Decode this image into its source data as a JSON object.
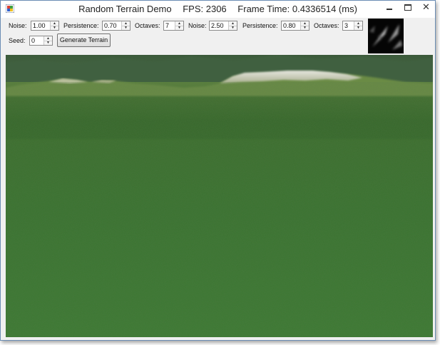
{
  "window": {
    "title": "Random Terrain Demo",
    "fps": "FPS: 2306",
    "frame_time": "Frame Time: 0.4336514 (ms)",
    "min_icon": "minimize-icon",
    "max_icon": "maximize-icon",
    "close_label": "✕"
  },
  "toolbar": {
    "noise1": {
      "label": "Noise:",
      "value": "1.00"
    },
    "persistence1": {
      "label": "Persistence:",
      "value": "0.70"
    },
    "octaves1": {
      "label": "Octaves:",
      "value": "7"
    },
    "noise2": {
      "label": "Noise:",
      "value": "2.50"
    },
    "persistence2": {
      "label": "Persistence:",
      "value": "0.80"
    },
    "octaves2": {
      "label": "Octaves:",
      "value": "3"
    },
    "seed": {
      "label": "Seed:",
      "value": "0"
    },
    "generate_label": "Generate Terrain",
    "arrow_up": "▲",
    "arrow_down": "▼"
  },
  "colors": {
    "grass": "#3f7a32",
    "grass_dark": "#2f5f27",
    "hills": "#6f8f4a",
    "snow": "#d8d8d0",
    "sky": "#4d6a48"
  }
}
